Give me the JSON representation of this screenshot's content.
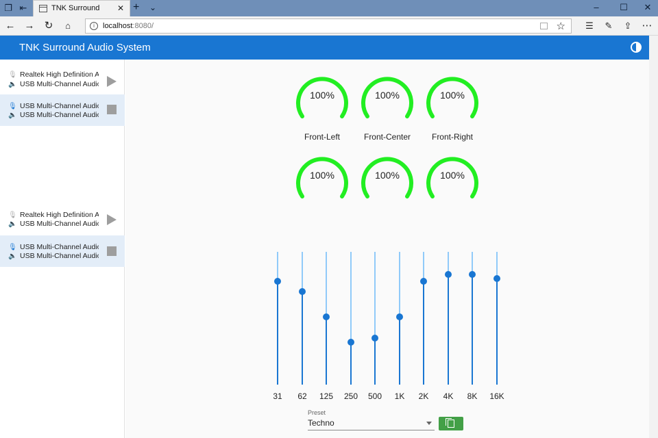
{
  "browser": {
    "tab_title": "TNK Surround",
    "tab_close": "✕",
    "url_host": "localhost",
    "url_rest": ":8080/",
    "window_controls": [
      "–",
      "☐",
      "✕"
    ]
  },
  "app": {
    "title": "TNK Surround Audio System"
  },
  "sidebar": {
    "groups": [
      {
        "devices": [
          {
            "input": "Realtek High Definition Audio",
            "output": "USB Multi-Channel Audio",
            "active": false,
            "action": "play"
          },
          {
            "input": "USB Multi-Channel Audio",
            "output": "USB Multi-Channel Audio",
            "active": true,
            "action": "stop"
          }
        ]
      },
      {
        "devices": [
          {
            "input": "Realtek High Definition Audio",
            "output": "USB Multi-Channel Audio",
            "active": false,
            "action": "play"
          },
          {
            "input": "USB Multi-Channel Audio",
            "output": "USB Multi-Channel Audio",
            "active": true,
            "action": "stop"
          }
        ]
      }
    ]
  },
  "gauges": {
    "color": "#22ee22",
    "row1": [
      {
        "value": "100%",
        "label": "Front-Left"
      },
      {
        "value": "100%",
        "label": "Front-Center"
      },
      {
        "value": "100%",
        "label": "Front-Right"
      }
    ],
    "row2": [
      {
        "value": "100%",
        "label": ""
      },
      {
        "value": "100%",
        "label": ""
      },
      {
        "value": "100%",
        "label": ""
      }
    ]
  },
  "equalizer": {
    "accent": "#1976d2",
    "bands": [
      {
        "label": "31",
        "level": 0.78
      },
      {
        "label": "62",
        "level": 0.7
      },
      {
        "label": "125",
        "level": 0.51
      },
      {
        "label": "250",
        "level": 0.32
      },
      {
        "label": "500",
        "level": 0.35
      },
      {
        "label": "1K",
        "level": 0.51
      },
      {
        "label": "2K",
        "level": 0.78
      },
      {
        "label": "4K",
        "level": 0.83
      },
      {
        "label": "8K",
        "level": 0.83
      },
      {
        "label": "16K",
        "level": 0.8
      }
    ]
  },
  "preset": {
    "label": "Preset",
    "value": "Techno"
  }
}
